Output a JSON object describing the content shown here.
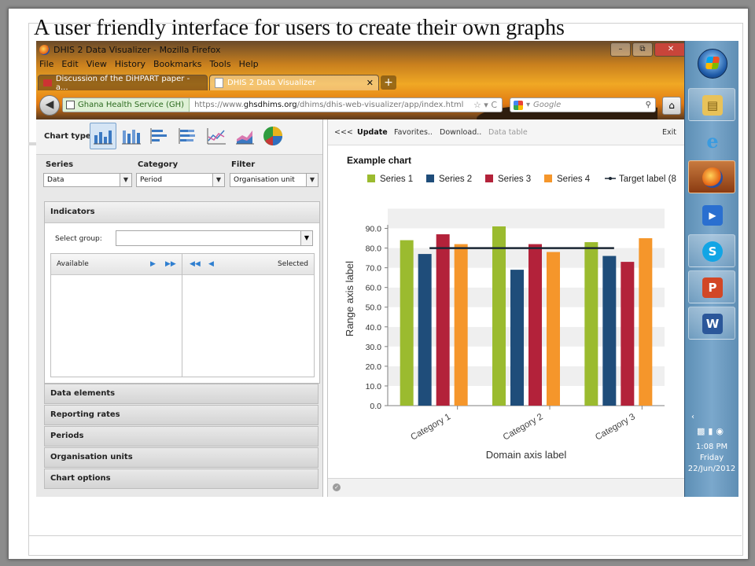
{
  "slide": {
    "title": "A user friendly interface for users to create their own graphs"
  },
  "browser": {
    "window_title": "DHIS 2 Data Visualizer - Mozilla Firefox",
    "menu": [
      "File",
      "Edit",
      "View",
      "History",
      "Bookmarks",
      "Tools",
      "Help"
    ],
    "tabs": [
      {
        "label": "Discussion of the DiHPART paper - a..."
      },
      {
        "label": "DHIS 2 Data Visualizer"
      }
    ],
    "site_identity": "Ghana Health Service (GH)",
    "url_prefix": "https://www.",
    "url_domain": "ghsdhims.org",
    "url_path": "/dhims/dhis-web-visualizer/app/index.html",
    "search_placeholder": "Google"
  },
  "app": {
    "chart_type_label": "Chart type",
    "dimensions": [
      {
        "label": "Series",
        "value": "Data"
      },
      {
        "label": "Category",
        "value": "Period"
      },
      {
        "label": "Filter",
        "value": "Organisation unit"
      }
    ],
    "indicators": {
      "header": "Indicators",
      "select_group_label": "Select group:",
      "available": "Available",
      "selected": "Selected"
    },
    "accordion": [
      "Data elements",
      "Reporting rates",
      "Periods",
      "Organisation units",
      "Chart options"
    ],
    "toolbar": {
      "collapse": "<<<",
      "update": "Update",
      "favorites": "Favorites..",
      "download": "Download..",
      "datatable": "Data table",
      "exit": "Exit"
    }
  },
  "chart_data": {
    "type": "bar",
    "title": "Example chart",
    "xlabel": "Domain axis label",
    "ylabel": "Range axis label",
    "categories": [
      "Category 1",
      "Category 2",
      "Category 3"
    ],
    "ylim": [
      0,
      90
    ],
    "yticks": [
      "0.0",
      "10.0",
      "20.0",
      "30.0",
      "40.0",
      "50.0",
      "60.0",
      "70.0",
      "80.0",
      "90.0"
    ],
    "series": [
      {
        "name": "Series 1",
        "color": "#9bbb2f",
        "values": [
          84,
          91,
          83
        ]
      },
      {
        "name": "Series 2",
        "color": "#1f4d7a",
        "values": [
          77,
          69,
          76
        ]
      },
      {
        "name": "Series 3",
        "color": "#b3223a",
        "values": [
          87,
          82,
          73
        ]
      },
      {
        "name": "Series 4",
        "color": "#f5962b",
        "values": [
          82,
          78,
          85
        ]
      }
    ],
    "target": {
      "label": "Target label (8",
      "value": 80,
      "color": "#1a2633"
    },
    "grid": true,
    "legend": "top"
  },
  "taskbar": {
    "time": "1:08 PM",
    "day": "Friday",
    "date": "22/Jun/2012"
  }
}
